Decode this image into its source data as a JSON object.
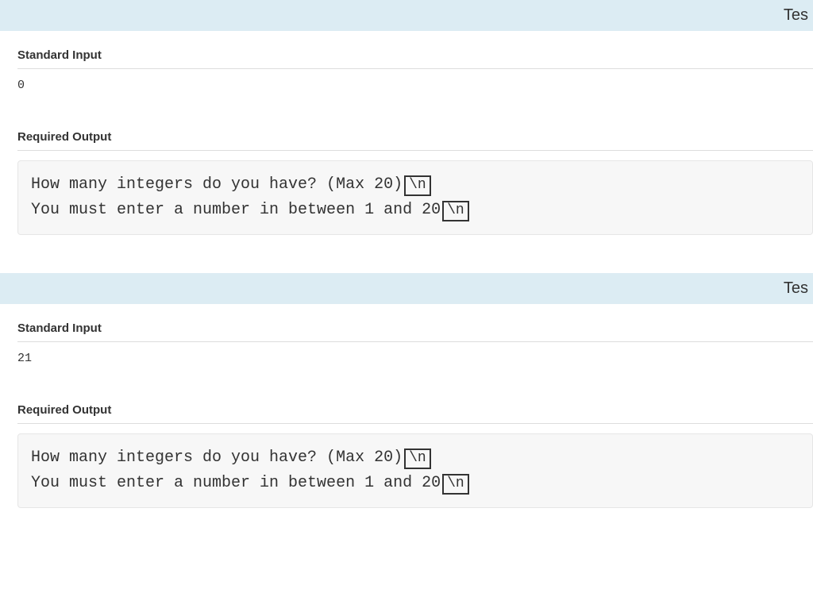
{
  "tests": [
    {
      "header": "Tes",
      "input_label": "Standard Input",
      "input_value": "0",
      "output_label": "Required Output",
      "lines": [
        {
          "text": "How many integers do you have? (Max 20)",
          "nl": "\\n"
        },
        {
          "text": "You must enter a number in between 1 and 20",
          "nl": "\\n"
        }
      ]
    },
    {
      "header": "Tes",
      "input_label": "Standard Input",
      "input_value": "21",
      "output_label": "Required Output",
      "lines": [
        {
          "text": "How many integers do you have? (Max 20)",
          "nl": "\\n"
        },
        {
          "text": "You must enter a number in between 1 and 20",
          "nl": "\\n"
        }
      ]
    }
  ]
}
